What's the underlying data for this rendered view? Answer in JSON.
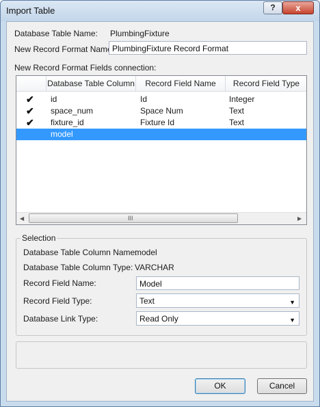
{
  "window": {
    "title": "Import Table",
    "help_label": "?",
    "close_label": "x"
  },
  "form": {
    "db_table_name_label": "Database Table Name:",
    "db_table_name_value": "PlumbingFixture",
    "new_format_label": "New Record Format Name:",
    "new_format_value": "PlumbingFixture Record Format",
    "fields_connection_label": "New Record Format Fields connection:"
  },
  "table": {
    "columns": [
      "Database Table Column",
      "Record Field Name",
      "Record Field Type"
    ],
    "rows": [
      {
        "checked": true,
        "check_glyph": "✔",
        "column": "id",
        "field_name": "Id",
        "field_type": "Integer"
      },
      {
        "checked": true,
        "check_glyph": "✔",
        "column": "space_num",
        "field_name": "Space Num",
        "field_type": "Text"
      },
      {
        "checked": true,
        "check_glyph": "✔",
        "column": "fixture_id",
        "field_name": "Fixture Id",
        "field_type": "Text"
      },
      {
        "checked": false,
        "check_glyph": "",
        "column": "model",
        "field_name": "",
        "field_type": "",
        "selected": true
      }
    ],
    "scroll_left": "◀",
    "scroll_right": "▶",
    "scroll_grip": "III"
  },
  "selection": {
    "title": "Selection",
    "col_name_label": "Database Table Column Name:",
    "col_name_value": "model",
    "col_type_label": "Database Table Column Type:",
    "col_type_value": "VARCHAR",
    "field_name_label": "Record Field Name:",
    "field_name_value": "Model",
    "field_type_label": "Record Field Type:",
    "field_type_value": "Text",
    "link_type_label": "Database Link Type:",
    "link_type_value": "Read Only",
    "dropdown_glyph": "▼"
  },
  "buttons": {
    "ok": "OK",
    "cancel": "Cancel"
  },
  "colors": {
    "selection_highlight": "#3399ff",
    "window_frame": "#c9dcee",
    "close_button": "#c7442e"
  }
}
